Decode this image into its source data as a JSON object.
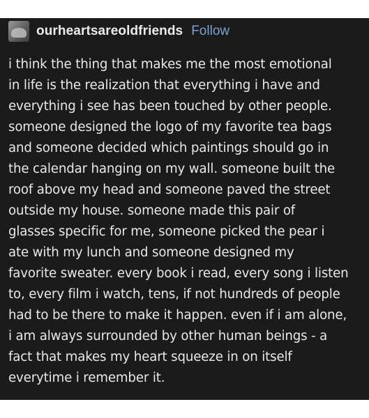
{
  "post": {
    "username": "ourheartsareoldfriends",
    "follow_label": "Follow",
    "avatar_icon": "avatar-image",
    "lines": [
      "i think the thing that makes me the most emotional",
      "in life is the realization that everything i have and",
      "everything i see has been touched by other people.",
      "someone designed the logo of my favorite tea bags",
      "and someone decided which paintings should go in",
      "the calendar hanging on my wall. someone built the",
      "roof above my head and someone paved the street",
      "outside my house. someone made this pair of",
      "glasses specific for me, someone picked the pear i",
      "ate with my lunch and someone designed my",
      "favorite sweater. every book i read, every song i listen",
      "to, every film i watch, tens, if not hundreds of people",
      "had to be there to make it happen. even if i am alone,",
      "i am always surrounded by other human beings - a",
      "fact that makes my heart squeeze in on itself",
      "everytime i remember it."
    ]
  },
  "colors": {
    "background": "#1b1b1b",
    "text": "#e9e9e9",
    "follow": "#7aa0d6"
  }
}
